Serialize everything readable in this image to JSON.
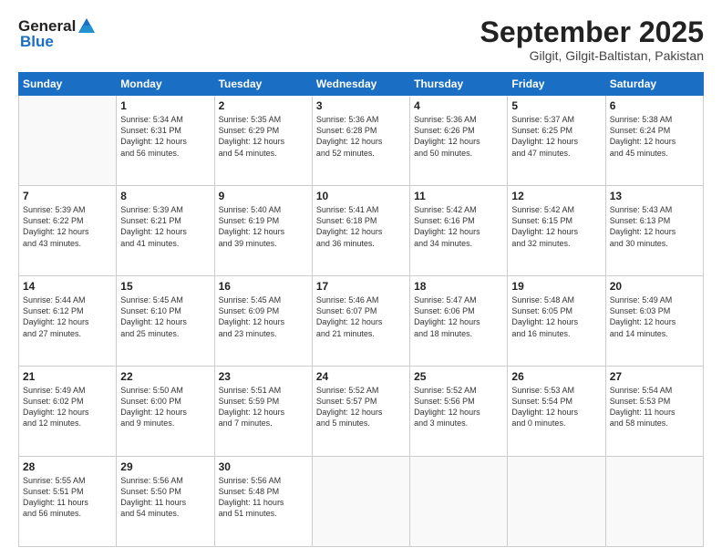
{
  "header": {
    "logo_general": "General",
    "logo_blue": "Blue",
    "month_title": "September 2025",
    "subtitle": "Gilgit, Gilgit-Baltistan, Pakistan"
  },
  "weekdays": [
    "Sunday",
    "Monday",
    "Tuesday",
    "Wednesday",
    "Thursday",
    "Friday",
    "Saturday"
  ],
  "weeks": [
    [
      {
        "day": "",
        "content": ""
      },
      {
        "day": "1",
        "content": "Sunrise: 5:34 AM\nSunset: 6:31 PM\nDaylight: 12 hours\nand 56 minutes."
      },
      {
        "day": "2",
        "content": "Sunrise: 5:35 AM\nSunset: 6:29 PM\nDaylight: 12 hours\nand 54 minutes."
      },
      {
        "day": "3",
        "content": "Sunrise: 5:36 AM\nSunset: 6:28 PM\nDaylight: 12 hours\nand 52 minutes."
      },
      {
        "day": "4",
        "content": "Sunrise: 5:36 AM\nSunset: 6:26 PM\nDaylight: 12 hours\nand 50 minutes."
      },
      {
        "day": "5",
        "content": "Sunrise: 5:37 AM\nSunset: 6:25 PM\nDaylight: 12 hours\nand 47 minutes."
      },
      {
        "day": "6",
        "content": "Sunrise: 5:38 AM\nSunset: 6:24 PM\nDaylight: 12 hours\nand 45 minutes."
      }
    ],
    [
      {
        "day": "7",
        "content": "Sunrise: 5:39 AM\nSunset: 6:22 PM\nDaylight: 12 hours\nand 43 minutes."
      },
      {
        "day": "8",
        "content": "Sunrise: 5:39 AM\nSunset: 6:21 PM\nDaylight: 12 hours\nand 41 minutes."
      },
      {
        "day": "9",
        "content": "Sunrise: 5:40 AM\nSunset: 6:19 PM\nDaylight: 12 hours\nand 39 minutes."
      },
      {
        "day": "10",
        "content": "Sunrise: 5:41 AM\nSunset: 6:18 PM\nDaylight: 12 hours\nand 36 minutes."
      },
      {
        "day": "11",
        "content": "Sunrise: 5:42 AM\nSunset: 6:16 PM\nDaylight: 12 hours\nand 34 minutes."
      },
      {
        "day": "12",
        "content": "Sunrise: 5:42 AM\nSunset: 6:15 PM\nDaylight: 12 hours\nand 32 minutes."
      },
      {
        "day": "13",
        "content": "Sunrise: 5:43 AM\nSunset: 6:13 PM\nDaylight: 12 hours\nand 30 minutes."
      }
    ],
    [
      {
        "day": "14",
        "content": "Sunrise: 5:44 AM\nSunset: 6:12 PM\nDaylight: 12 hours\nand 27 minutes."
      },
      {
        "day": "15",
        "content": "Sunrise: 5:45 AM\nSunset: 6:10 PM\nDaylight: 12 hours\nand 25 minutes."
      },
      {
        "day": "16",
        "content": "Sunrise: 5:45 AM\nSunset: 6:09 PM\nDaylight: 12 hours\nand 23 minutes."
      },
      {
        "day": "17",
        "content": "Sunrise: 5:46 AM\nSunset: 6:07 PM\nDaylight: 12 hours\nand 21 minutes."
      },
      {
        "day": "18",
        "content": "Sunrise: 5:47 AM\nSunset: 6:06 PM\nDaylight: 12 hours\nand 18 minutes."
      },
      {
        "day": "19",
        "content": "Sunrise: 5:48 AM\nSunset: 6:05 PM\nDaylight: 12 hours\nand 16 minutes."
      },
      {
        "day": "20",
        "content": "Sunrise: 5:49 AM\nSunset: 6:03 PM\nDaylight: 12 hours\nand 14 minutes."
      }
    ],
    [
      {
        "day": "21",
        "content": "Sunrise: 5:49 AM\nSunset: 6:02 PM\nDaylight: 12 hours\nand 12 minutes."
      },
      {
        "day": "22",
        "content": "Sunrise: 5:50 AM\nSunset: 6:00 PM\nDaylight: 12 hours\nand 9 minutes."
      },
      {
        "day": "23",
        "content": "Sunrise: 5:51 AM\nSunset: 5:59 PM\nDaylight: 12 hours\nand 7 minutes."
      },
      {
        "day": "24",
        "content": "Sunrise: 5:52 AM\nSunset: 5:57 PM\nDaylight: 12 hours\nand 5 minutes."
      },
      {
        "day": "25",
        "content": "Sunrise: 5:52 AM\nSunset: 5:56 PM\nDaylight: 12 hours\nand 3 minutes."
      },
      {
        "day": "26",
        "content": "Sunrise: 5:53 AM\nSunset: 5:54 PM\nDaylight: 12 hours\nand 0 minutes."
      },
      {
        "day": "27",
        "content": "Sunrise: 5:54 AM\nSunset: 5:53 PM\nDaylight: 11 hours\nand 58 minutes."
      }
    ],
    [
      {
        "day": "28",
        "content": "Sunrise: 5:55 AM\nSunset: 5:51 PM\nDaylight: 11 hours\nand 56 minutes."
      },
      {
        "day": "29",
        "content": "Sunrise: 5:56 AM\nSunset: 5:50 PM\nDaylight: 11 hours\nand 54 minutes."
      },
      {
        "day": "30",
        "content": "Sunrise: 5:56 AM\nSunset: 5:48 PM\nDaylight: 11 hours\nand 51 minutes."
      },
      {
        "day": "",
        "content": ""
      },
      {
        "day": "",
        "content": ""
      },
      {
        "day": "",
        "content": ""
      },
      {
        "day": "",
        "content": ""
      }
    ]
  ]
}
